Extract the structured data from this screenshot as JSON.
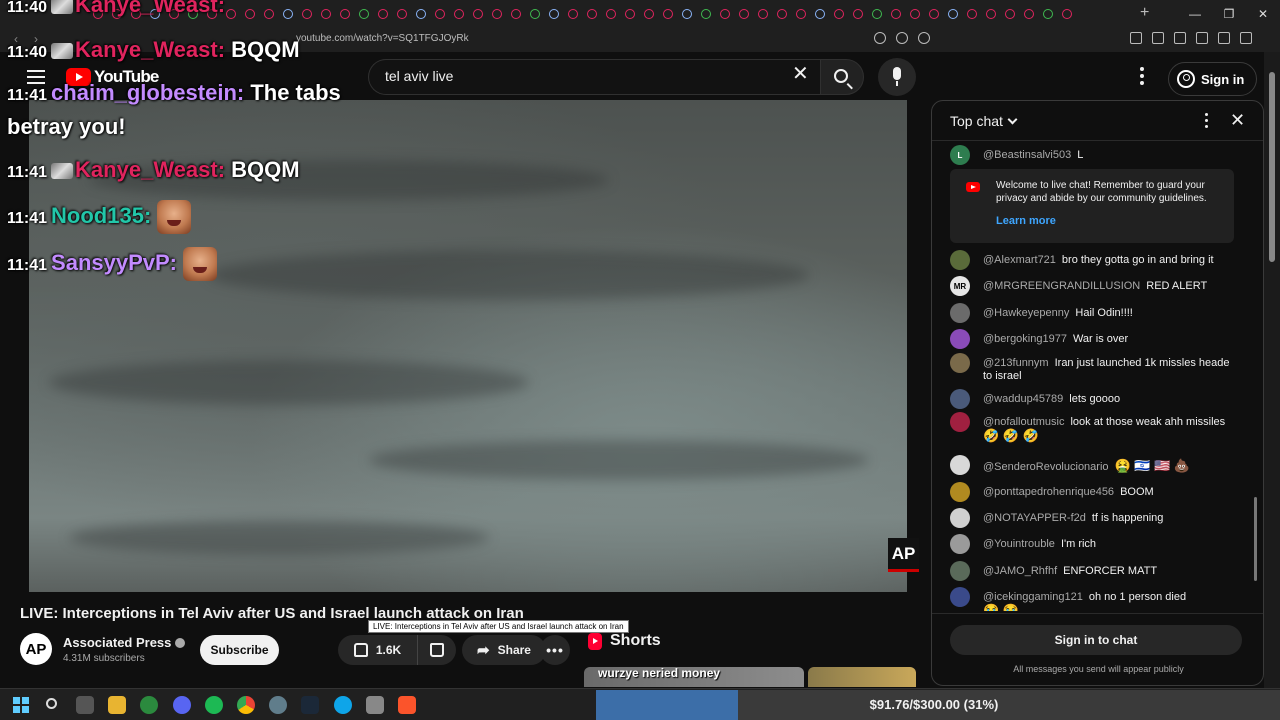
{
  "browser": {
    "url": "youtube.com/watch?v=SQ1TFGJOyRk",
    "window_controls": [
      "—",
      "❐",
      "✕"
    ]
  },
  "header": {
    "logo_text": "YouTube",
    "search_value": "tel aviv live",
    "sign_in_label": "Sign in"
  },
  "overlay_chat": [
    {
      "time": "11:40",
      "user": "Kanye_Weast:",
      "text": "BQQM"
    },
    {
      "time": "11:41",
      "user": "chaim_globestein:",
      "text": "The tabs",
      "text2": "betray you!"
    },
    {
      "time": "11:41",
      "user": "Kanye_Weast:",
      "text": "BQQM"
    },
    {
      "time": "11:41",
      "user": "Nood135:",
      "text": ""
    },
    {
      "time": "11:41",
      "user": "SansyyPvP:",
      "text": ""
    }
  ],
  "video": {
    "watermark": "AP",
    "title": "LIVE: Interceptions in Tel Aviv after US and Israel launch attack on Iran",
    "tooltip": "LIVE: Interceptions in Tel Aviv after US and Israel launch attack on Iran"
  },
  "channel": {
    "avatar_text": "AP",
    "name": "Associated Press",
    "subscribers": "4.31M subscribers",
    "subscribe_label": "Subscribe"
  },
  "actions": {
    "likes": "1.6K",
    "share_label": "Share",
    "more_label": "•••"
  },
  "shorts": {
    "label": "Shorts",
    "first_caption": "wurzye neried money"
  },
  "live_chat": {
    "header": "Top chat",
    "welcome_text": "Welcome to live chat! Remember to guard your privacy and abide by our community guidelines.",
    "learn_more": "Learn more",
    "sign_in_label": "Sign in to chat",
    "public_note": "All messages you send will appear publicly",
    "messages": [
      {
        "user": "@Beastinsalvi503",
        "text": "L",
        "avatar": "L",
        "color": "#2e7d4f"
      },
      {
        "user": "@Alexmart721",
        "text": "bro they gotta go in and bring it",
        "avatar": "",
        "color": "#5a6b3a"
      },
      {
        "user": "@MRGREENGRANDILLUSION",
        "text": "RED ALERT",
        "avatar": "MR",
        "color": "#e6e6e6"
      },
      {
        "user": "@Hawkeyepenny",
        "text": "Hail Odin!!!!",
        "avatar": "",
        "color": "#6b6b6b"
      },
      {
        "user": "@bergoking1977",
        "text": "War is over",
        "avatar": "",
        "color": "#8a4bb8"
      },
      {
        "user": "@213funnym",
        "text": "Iran just launched 1k missles heade to israel",
        "avatar": "",
        "color": "#7a6a4a"
      },
      {
        "user": "@waddup45789",
        "text": "lets goooo",
        "avatar": "",
        "color": "#4a5a7a"
      },
      {
        "user": "@nofalloutmusic",
        "text": "look at those weak ahh missiles",
        "emoji": "🤣 🤣 🤣",
        "avatar": "",
        "color": "#a02040"
      },
      {
        "user": "@SenderoRevolucionario",
        "text": "",
        "emoji": "🤮 🇮🇱 🇺🇸 💩",
        "avatar": "",
        "color": "#d8d8d8"
      },
      {
        "user": "@ponttapedrohenrique456",
        "text": "BOOM",
        "avatar": "",
        "color": "#b08a20"
      },
      {
        "user": "@NOTAYAPPER-f2d",
        "text": "tf is happening",
        "avatar": "",
        "color": "#cfcfcf"
      },
      {
        "user": "@Youintrouble",
        "text": "I'm rich",
        "avatar": "",
        "color": "#9a9a9a"
      },
      {
        "user": "@JAMO_Rhfhf",
        "text": "ENFORCER MATT",
        "avatar": "",
        "color": "#5a6a5a"
      },
      {
        "user": "@icekinggaming121",
        "text": "oh no 1 person died",
        "emoji": "😭 😭",
        "avatar": "",
        "color": "#3a4a8a"
      }
    ]
  },
  "taskbar": {
    "progress_text": "$91.76/$300.00 (31%)",
    "progress_fraction": 0.31
  },
  "colors": {
    "youtube_red": "#ff0000",
    "link_blue": "#3ea6ff",
    "progress_blue": "#3c6ea8"
  }
}
